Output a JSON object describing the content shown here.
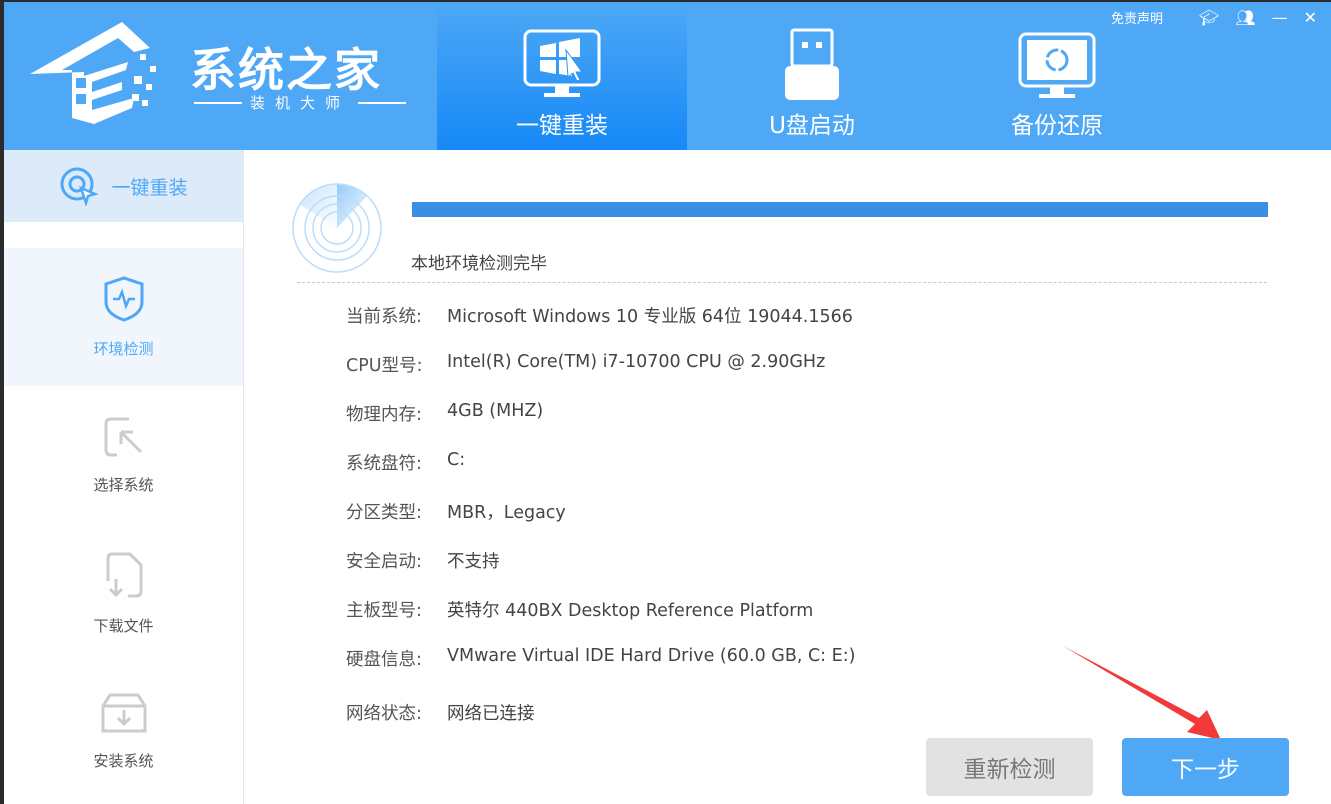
{
  "logo": {
    "title": "系统之家",
    "subtitle": "装机大师"
  },
  "tabs": [
    {
      "label": "一键重装",
      "active": true
    },
    {
      "label": "U盘启动"
    },
    {
      "label": "备份还原"
    }
  ],
  "topright": {
    "disclaimer": "免责声明"
  },
  "sidebar": {
    "top_label": "一键重装",
    "items": [
      {
        "label": "环境检测",
        "active": true
      },
      {
        "label": "选择系统"
      },
      {
        "label": "下载文件"
      },
      {
        "label": "安装系统"
      }
    ]
  },
  "main": {
    "progress_percent": 100,
    "status": "本地环境检测完毕",
    "rows": [
      {
        "label": "当前系统:",
        "value": "Microsoft Windows 10 专业版 64位 19044.1566"
      },
      {
        "label": "CPU型号:",
        "value": "Intel(R) Core(TM) i7-10700 CPU @ 2.90GHz"
      },
      {
        "label": "物理内存:",
        "value": "4GB (MHZ)"
      },
      {
        "label": "系统盘符:",
        "value": "C:"
      },
      {
        "label": "分区类型:",
        "value": "MBR，Legacy"
      },
      {
        "label": "安全启动:",
        "value": "不支持"
      },
      {
        "label": "主板型号:",
        "value": "英特尔 440BX Desktop Reference Platform"
      },
      {
        "label": "硬盘信息:",
        "value": "VMware Virtual IDE Hard Drive  (60.0 GB, C: E:)"
      },
      {
        "label": "网络状态:",
        "value": "网络已连接"
      }
    ],
    "recheck_label": "重新检测",
    "next_label": "下一步"
  },
  "colors": {
    "brand": "#4ea8f6",
    "progress": "#3a8ee6",
    "arrow": "#f23a3a"
  }
}
